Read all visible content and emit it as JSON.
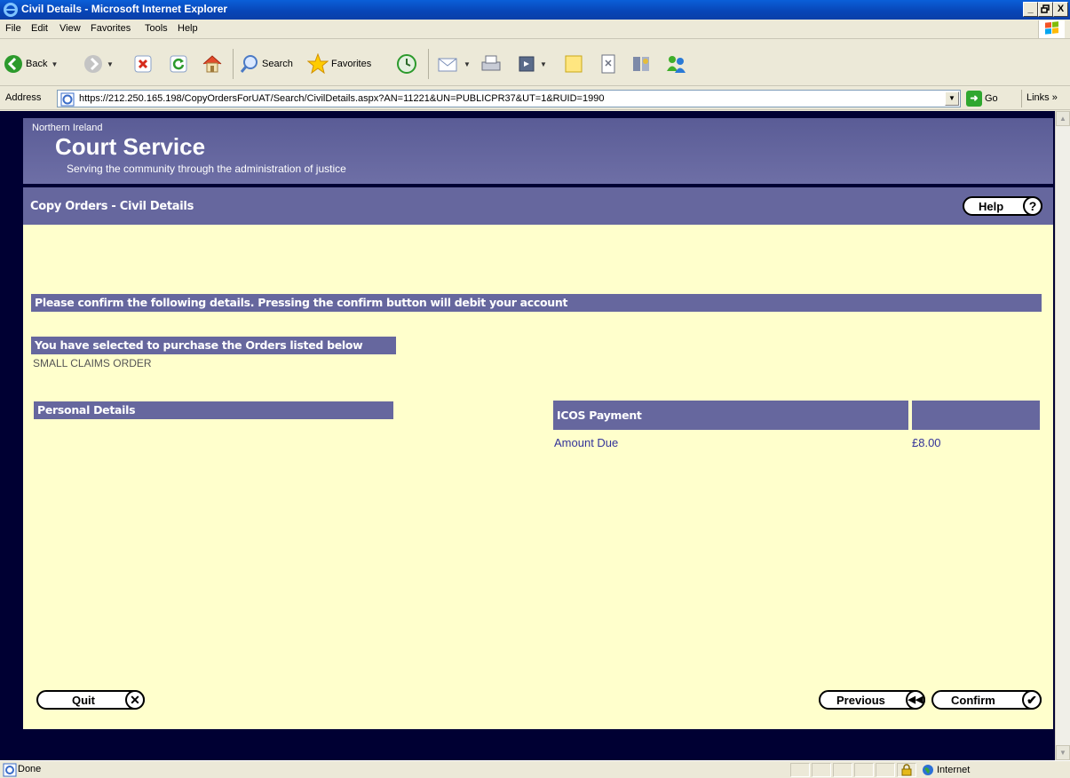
{
  "window": {
    "title": "Civil Details - Microsoft Internet Explorer",
    "min": "_",
    "max": " ",
    "close": "X"
  },
  "menu": {
    "file": "File",
    "edit": "Edit",
    "view": "View",
    "favorites": "Favorites",
    "tools": "Tools",
    "help": "Help"
  },
  "toolbar": {
    "back": "Back",
    "search": "Search",
    "favorites": "Favorites"
  },
  "address": {
    "label": "Address",
    "url": "https://212.250.165.198/CopyOrdersForUAT/Search/CivilDetails.aspx?AN=11221&UN=PUBLICPR37&UT=1&RUID=1990",
    "go": "Go",
    "links": "Links"
  },
  "banner": {
    "org": "Northern Ireland",
    "name": "Court Service",
    "tagline": "Serving the community through the administration of justice"
  },
  "page": {
    "title": "Copy Orders - Civil Details",
    "help_label": "Help",
    "help_icon": "?",
    "confirm_heading": "Please confirm the following details. Pressing the confirm button will debit your account",
    "orders_heading": "You have selected to purchase the Orders listed below",
    "orders": [
      "SMALL CLAIMS ORDER"
    ],
    "personal_heading": "Personal Details",
    "payment_heading": "ICOS Payment",
    "amount_label": "Amount Due",
    "amount_value": "£8.00"
  },
  "buttons": {
    "quit": "Quit",
    "previous": "Previous",
    "confirm": "Confirm"
  },
  "status": {
    "text": "Done",
    "zone": "Internet"
  },
  "colors": {
    "header_bg": "#66679e",
    "content_bg": "#ffffcc",
    "frame_bg": "#000033",
    "link_blue": "#333399"
  }
}
